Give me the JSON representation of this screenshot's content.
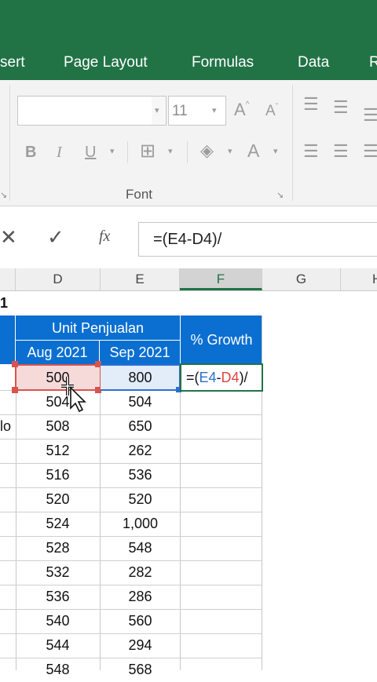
{
  "ribbon": {
    "tabs": [
      {
        "label": "sert"
      },
      {
        "label": "Page Layout"
      },
      {
        "label": "Formulas"
      },
      {
        "label": "Data"
      },
      {
        "label": "R"
      }
    ],
    "font_size": "11",
    "font_group_label": "Font",
    "bold": "B",
    "italic": "I",
    "underline": "U",
    "grow_font": "A",
    "shrink_font": "A",
    "font_color": "A"
  },
  "formula_bar": {
    "cancel": "✕",
    "enter": "✓",
    "fx": "fx",
    "formula": "=(E4-D4)/"
  },
  "columns": [
    "D",
    "E",
    "F",
    "G",
    "H"
  ],
  "sheet": {
    "row_fragment": "1",
    "header_group": "Unit Penjualan",
    "header_aug": "Aug 2021",
    "header_sep": "Sep 2021",
    "header_growth": "% Growth",
    "col_c_fragment": "lo",
    "active_formula": {
      "eq": "=(",
      "e4": "E4",
      "minus": "-",
      "d4": "D4",
      "tail": ")/"
    },
    "rows": [
      {
        "d": "500",
        "e": "800"
      },
      {
        "d": "504",
        "e": "504"
      },
      {
        "d": "508",
        "e": "650"
      },
      {
        "d": "512",
        "e": "262"
      },
      {
        "d": "516",
        "e": "536"
      },
      {
        "d": "520",
        "e": "520"
      },
      {
        "d": "524",
        "e": "1,000"
      },
      {
        "d": "528",
        "e": "548"
      },
      {
        "d": "532",
        "e": "282"
      },
      {
        "d": "536",
        "e": "286"
      },
      {
        "d": "540",
        "e": "560"
      },
      {
        "d": "544",
        "e": "294"
      },
      {
        "d": "548",
        "e": "568"
      }
    ]
  },
  "colors": {
    "excel_green": "#217346",
    "header_blue": "#0b6fd1",
    "ref_red": "#e0443e",
    "ref_blue": "#2e6fd0"
  }
}
